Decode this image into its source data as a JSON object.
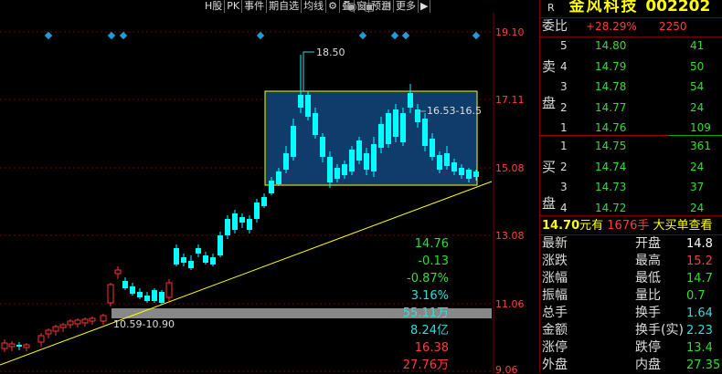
{
  "toolbar": {
    "items": [
      "H股",
      "PK",
      "事件",
      "期自选",
      "均线",
      "叠",
      "窗",
      "预测",
      "更多"
    ]
  },
  "chart_data": {
    "type": "candlestick",
    "y_axis_labels": [
      "19.10",
      "17.11",
      "15.08",
      "13.08",
      "11.06",
      "9.06"
    ],
    "annotations": {
      "high_label": "18.50",
      "range_label": "16.53-16.5",
      "support_label": "10.59-10.90"
    },
    "colors": {
      "up": "#ff3333",
      "down": "#00ffff",
      "box_fill": "#0f3c6a",
      "box_border": "#ffff00",
      "trendline": "#ffff00",
      "band": "#888888"
    }
  },
  "stock": {
    "flag": "R",
    "name": "金风科技",
    "code": "002202"
  },
  "weibi": {
    "label": "委比",
    "value": "+28.29%",
    "diff": "2250"
  },
  "sell": {
    "label_top": "卖",
    "label_bottom": "盘",
    "rows": [
      {
        "level": "5",
        "price": "14.80",
        "vol": "41"
      },
      {
        "level": "4",
        "price": "14.79",
        "vol": "50"
      },
      {
        "level": "3",
        "price": "14.78",
        "vol": "54"
      },
      {
        "level": "2",
        "price": "14.77",
        "vol": "24"
      },
      {
        "level": "1",
        "price": "14.76",
        "vol": "109"
      }
    ]
  },
  "buy": {
    "label_top": "买",
    "label_bottom": "盘",
    "rows": [
      {
        "level": "1",
        "price": "14.75",
        "vol": "361"
      },
      {
        "level": "2",
        "price": "14.74",
        "vol": "24"
      },
      {
        "level": "3",
        "price": "14.73",
        "vol": "37"
      },
      {
        "level": "4",
        "price": "14.72",
        "vol": "24"
      }
    ]
  },
  "big_order": {
    "price": "14.70",
    "text1": "元有",
    "vol": "1676手",
    "text2": "大买单",
    "text3": "查看"
  },
  "stats": [
    {
      "l1": "最新",
      "v1": "14.76",
      "c1": "green",
      "l2": "开盘",
      "v2": "14.8",
      "c2": "white"
    },
    {
      "l1": "涨跌",
      "v1": "-0.13",
      "c1": "green",
      "l2": "最高",
      "v2": "15.2",
      "c2": "red"
    },
    {
      "l1": "涨幅",
      "v1": "-0.87%",
      "c1": "green",
      "l2": "最低",
      "v2": "14.7",
      "c2": "green"
    },
    {
      "l1": "振幅",
      "v1": "3.16%",
      "c1": "cyan",
      "l2": "量比",
      "v2": "0.7",
      "c2": "green"
    },
    {
      "l1": "总手",
      "v1": "55.11万",
      "c1": "cyan",
      "l2": "换手",
      "v2": "1.64",
      "c2": "cyan"
    },
    {
      "l1": "金额",
      "v1": "8.24亿",
      "c1": "cyan",
      "l2": "换手(实)",
      "v2": "2.23",
      "c2": "cyan"
    },
    {
      "l1": "涨停",
      "v1": "16.38",
      "c1": "red",
      "l2": "跌停",
      "v2": "13.4",
      "c2": "green"
    },
    {
      "l1": "外盘",
      "v1": "27.76万",
      "c1": "red",
      "l2": "内盘",
      "v2": "27.35",
      "c2": "green"
    }
  ]
}
